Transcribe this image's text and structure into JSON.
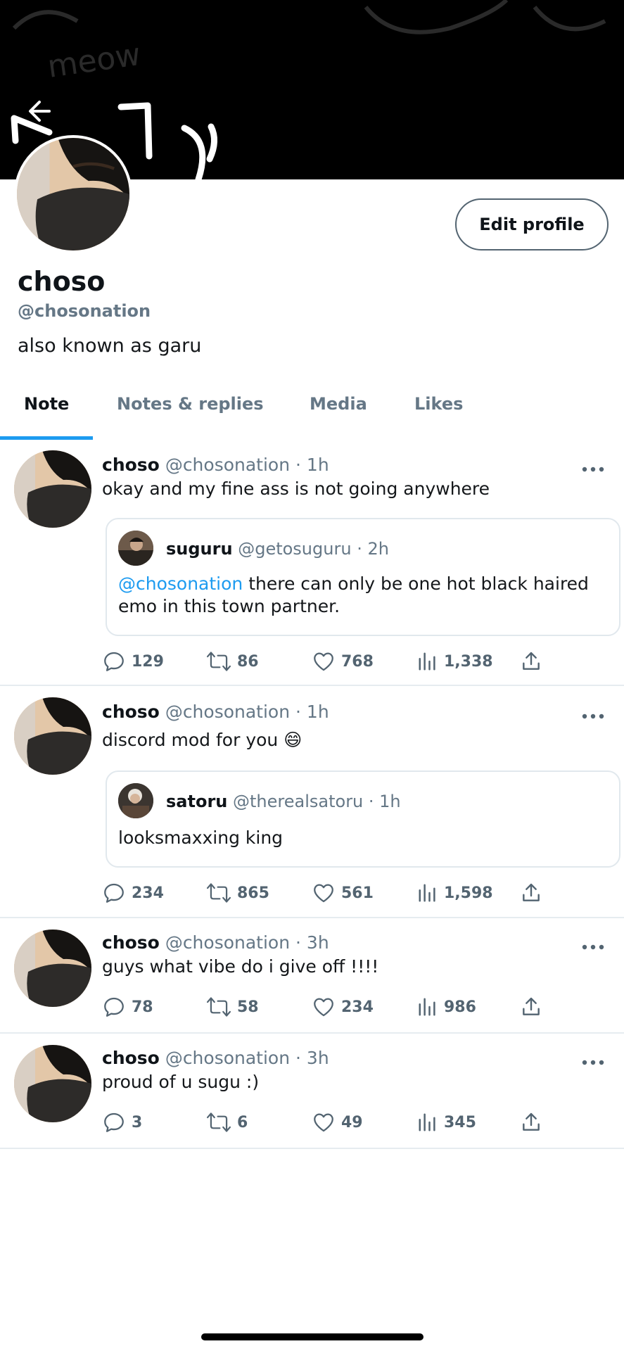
{
  "banner": {
    "back_icon": "arrow-left-icon",
    "doodle_text": "meow"
  },
  "profile": {
    "name": "choso",
    "handle": "@chosonation",
    "bio": "also known as garu",
    "edit_label": "Edit profile"
  },
  "tabs": [
    "Note",
    "Notes & replies",
    "Media",
    "Likes"
  ],
  "active_tab": "Note",
  "accent_color": "#1d9bf0",
  "tweets": [
    {
      "name": "choso",
      "handle": "@chosonation",
      "time": "· 1h",
      "text": "okay and my fine ass is not going anywhere",
      "quote": {
        "name": "suguru",
        "handle": "@getosuguru",
        "time": "· 2h",
        "mention": "@chosonation",
        "text": " there can only be one hot black haired",
        "text2": "emo in this town partner."
      },
      "replies": "129",
      "reposts": "86",
      "likes": "768",
      "views": "1,338"
    },
    {
      "name": "choso",
      "handle": "@chosonation",
      "time": "· 1h",
      "text": "discord mod for you 😄",
      "quote": {
        "name": "satoru",
        "handle": "@therealsatoru",
        "time": "· 1h",
        "text": "looksmaxxing king"
      },
      "replies": "234",
      "reposts": "865",
      "likes": "561",
      "views": "1,598"
    },
    {
      "name": "choso",
      "handle": "@chosonation",
      "time": "· 3h",
      "text": "guys what vibe do i give off !!!!",
      "replies": "78",
      "reposts": "58",
      "likes": "234",
      "views": "986"
    },
    {
      "name": "choso",
      "handle": "@chosonation",
      "time": "· 3h",
      "text": "proud of u sugu :)",
      "replies": "3",
      "reposts": "6",
      "likes": "49",
      "views": "345"
    }
  ]
}
